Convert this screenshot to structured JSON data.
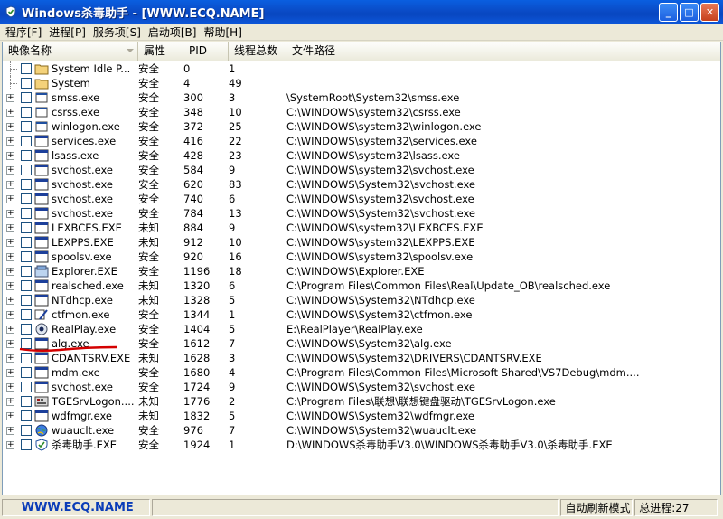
{
  "window": {
    "title": "Windows杀毒助手 - [WWW.ECQ.NAME]",
    "minimize": "_",
    "maximize": "□",
    "close": "✕"
  },
  "menu": [
    "程序[F]",
    "进程[P]",
    "服务项[S]",
    "启动项[B]",
    "帮助[H]"
  ],
  "columns": [
    "映像名称",
    "属性",
    "PID",
    "线程总数",
    "文件路径"
  ],
  "processes": [
    {
      "name": "System Idle P...",
      "attr": "安全",
      "pid": "0",
      "threads": "1",
      "path": "",
      "icon": "folder-icon",
      "expand": false
    },
    {
      "name": "System",
      "attr": "安全",
      "pid": "4",
      "threads": "49",
      "path": "",
      "icon": "folder-icon",
      "expand": false
    },
    {
      "name": "smss.exe",
      "attr": "安全",
      "pid": "300",
      "threads": "3",
      "path": "\\SystemRoot\\System32\\smss.exe",
      "icon": "exe-icon",
      "expand": true
    },
    {
      "name": "csrss.exe",
      "attr": "安全",
      "pid": "348",
      "threads": "10",
      "path": "C:\\WINDOWS\\system32\\csrss.exe",
      "icon": "exe-icon",
      "expand": true
    },
    {
      "name": "winlogon.exe",
      "attr": "安全",
      "pid": "372",
      "threads": "25",
      "path": "C:\\WINDOWS\\system32\\winlogon.exe",
      "icon": "exe-icon",
      "expand": true
    },
    {
      "name": "services.exe",
      "attr": "安全",
      "pid": "416",
      "threads": "22",
      "path": "C:\\WINDOWS\\system32\\services.exe",
      "icon": "window-icon",
      "expand": true
    },
    {
      "name": "lsass.exe",
      "attr": "安全",
      "pid": "428",
      "threads": "23",
      "path": "C:\\WINDOWS\\system32\\lsass.exe",
      "icon": "window-icon",
      "expand": true
    },
    {
      "name": "svchost.exe",
      "attr": "安全",
      "pid": "584",
      "threads": "9",
      "path": "C:\\WINDOWS\\system32\\svchost.exe",
      "icon": "window-icon",
      "expand": true
    },
    {
      "name": "svchost.exe",
      "attr": "安全",
      "pid": "620",
      "threads": "83",
      "path": "C:\\WINDOWS\\System32\\svchost.exe",
      "icon": "window-icon",
      "expand": true
    },
    {
      "name": "svchost.exe",
      "attr": "安全",
      "pid": "740",
      "threads": "6",
      "path": "C:\\WINDOWS\\system32\\svchost.exe",
      "icon": "window-icon",
      "expand": true
    },
    {
      "name": "svchost.exe",
      "attr": "安全",
      "pid": "784",
      "threads": "13",
      "path": "C:\\WINDOWS\\System32\\svchost.exe",
      "icon": "window-icon",
      "expand": true
    },
    {
      "name": "LEXBCES.EXE",
      "attr": "未知",
      "pid": "884",
      "threads": "9",
      "path": "C:\\WINDOWS\\system32\\LEXBCES.EXE",
      "icon": "window-icon",
      "expand": true
    },
    {
      "name": "LEXPPS.EXE",
      "attr": "未知",
      "pid": "912",
      "threads": "10",
      "path": "C:\\WINDOWS\\system32\\LEXPPS.EXE",
      "icon": "window-icon",
      "expand": true
    },
    {
      "name": "spoolsv.exe",
      "attr": "安全",
      "pid": "920",
      "threads": "16",
      "path": "C:\\WINDOWS\\system32\\spoolsv.exe",
      "icon": "window-icon",
      "expand": true
    },
    {
      "name": "Explorer.EXE",
      "attr": "安全",
      "pid": "1196",
      "threads": "18",
      "path": "C:\\WINDOWS\\Explorer.EXE",
      "icon": "explorer-icon",
      "expand": true
    },
    {
      "name": "realsched.exe",
      "attr": "未知",
      "pid": "1320",
      "threads": "6",
      "path": "C:\\Program Files\\Common Files\\Real\\Update_OB\\realsched.exe",
      "icon": "window-icon",
      "expand": true
    },
    {
      "name": "NTdhcp.exe",
      "attr": "未知",
      "pid": "1328",
      "threads": "5",
      "path": "C:\\WINDOWS\\System32\\NTdhcp.exe",
      "icon": "window-icon",
      "expand": true
    },
    {
      "name": "ctfmon.exe",
      "attr": "安全",
      "pid": "1344",
      "threads": "1",
      "path": "C:\\WINDOWS\\System32\\ctfmon.exe",
      "icon": "pen-icon",
      "expand": true
    },
    {
      "name": "RealPlay.exe",
      "attr": "安全",
      "pid": "1404",
      "threads": "5",
      "path": "E:\\RealPlayer\\RealPlay.exe",
      "icon": "realplayer-icon",
      "expand": true
    },
    {
      "name": "alg.exe",
      "attr": "安全",
      "pid": "1612",
      "threads": "7",
      "path": "C:\\WINDOWS\\System32\\alg.exe",
      "icon": "window-icon",
      "expand": true
    },
    {
      "name": "CDANTSRV.EXE",
      "attr": "未知",
      "pid": "1628",
      "threads": "3",
      "path": "C:\\WINDOWS\\System32\\DRIVERS\\CDANTSRV.EXE",
      "icon": "window-icon",
      "expand": true
    },
    {
      "name": "mdm.exe",
      "attr": "安全",
      "pid": "1680",
      "threads": "4",
      "path": "C:\\Program Files\\Common Files\\Microsoft Shared\\VS7Debug\\mdm....",
      "icon": "window-icon",
      "expand": true
    },
    {
      "name": "svchost.exe",
      "attr": "安全",
      "pid": "1724",
      "threads": "9",
      "path": "C:\\WINDOWS\\System32\\svchost.exe",
      "icon": "window-icon",
      "expand": true
    },
    {
      "name": "TGESrvLogon....",
      "attr": "未知",
      "pid": "1776",
      "threads": "2",
      "path": "C:\\Program Files\\联想\\联想键盘驱动\\TGESrvLogon.exe",
      "icon": "keyboard-icon",
      "expand": true
    },
    {
      "name": "wdfmgr.exe",
      "attr": "未知",
      "pid": "1832",
      "threads": "5",
      "path": "C:\\WINDOWS\\System32\\wdfmgr.exe",
      "icon": "window-icon",
      "expand": true
    },
    {
      "name": "wuauclt.exe",
      "attr": "安全",
      "pid": "976",
      "threads": "7",
      "path": "C:\\WINDOWS\\System32\\wuauclt.exe",
      "icon": "globe-icon",
      "expand": true
    },
    {
      "name": "杀毒助手.EXE",
      "attr": "安全",
      "pid": "1924",
      "threads": "1",
      "path": "D:\\WINDOWS杀毒助手V3.0\\WINDOWS杀毒助手V3.0\\杀毒助手.EXE",
      "icon": "shield-icon",
      "expand": true
    }
  ],
  "status": {
    "url": "WWW.ECQ.NAME",
    "mode": "自动刷新模式",
    "total": "总进程:27"
  },
  "colors": {
    "titlebar": "#0a4cc8",
    "annotation": "#d40000",
    "status_url": "#0a3cb8"
  }
}
